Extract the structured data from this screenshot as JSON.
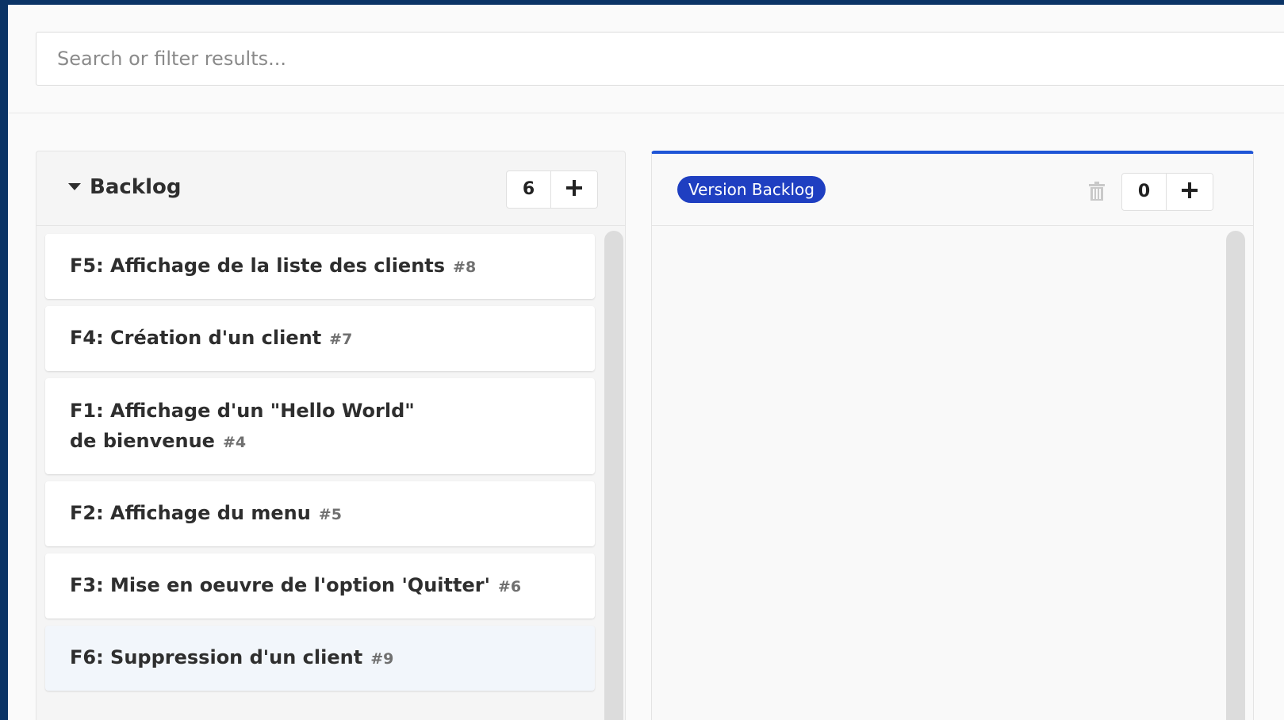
{
  "search": {
    "placeholder": "Search or filter results..."
  },
  "boards": [
    {
      "title": "Backlog",
      "count": "6",
      "cards": [
        {
          "title": "F5: Affichage de la liste des clients",
          "ref": "#8"
        },
        {
          "title": "F4: Création d'un client",
          "ref": "#7"
        },
        {
          "title": "F1: Affichage d'un \"Hello World\" de bienvenue",
          "ref": "#4"
        },
        {
          "title": "F2: Affichage du menu",
          "ref": "#5"
        },
        {
          "title": "F3: Mise en oeuvre de l'option 'Quitter'",
          "ref": "#6"
        },
        {
          "title": "F6: Suppression d'un client",
          "ref": "#9"
        }
      ]
    },
    {
      "title": "Version Backlog",
      "count": "0",
      "cards": []
    }
  ],
  "colors": {
    "accent": "#1f55d6",
    "badge": "#1f3fc1",
    "frame": "#0b3466"
  },
  "icons": {
    "collapse": "caret-down-icon",
    "add": "plus-icon",
    "delete": "trash-icon"
  }
}
